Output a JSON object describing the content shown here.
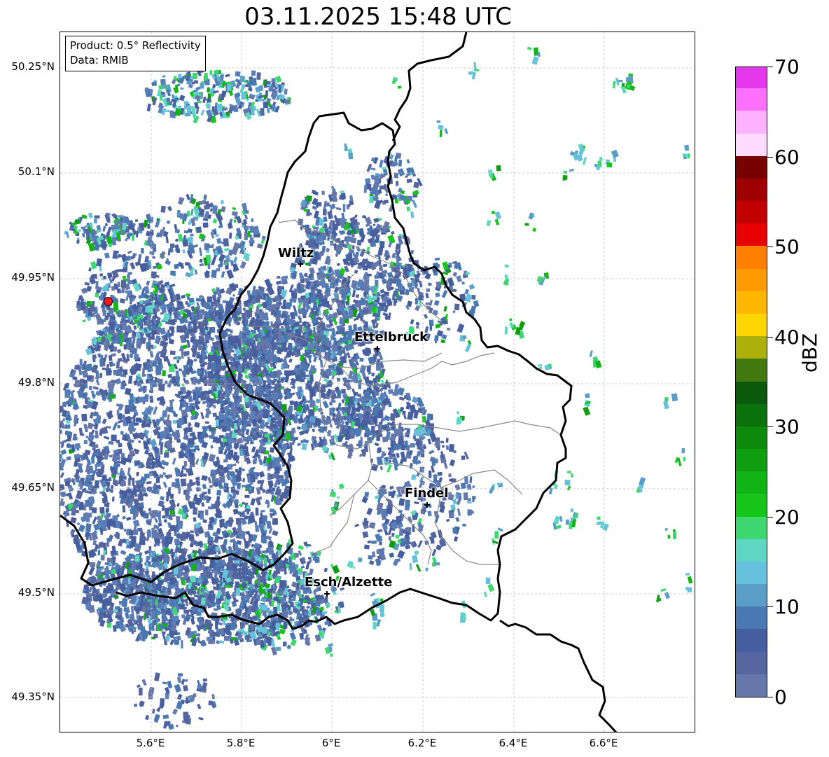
{
  "title": "03.11.2025 15:48 UTC",
  "info_box": {
    "product": "Product: 0.5° Reflectivity",
    "source": "Data: RMIB"
  },
  "axes": {
    "lat_labels": [
      "50.25°N",
      "50.1°N",
      "49.95°N",
      "49.8°N",
      "49.65°N",
      "49.5°N",
      "49.35°N"
    ],
    "lon_labels": [
      "5.6°E",
      "5.8°E",
      "6°E",
      "6.2°E",
      "6.4°E",
      "6.6°E"
    ]
  },
  "cities": [
    {
      "name": "Wiltz"
    },
    {
      "name": "Ettelbruck"
    },
    {
      "name": "Findel"
    },
    {
      "name": "Esch/Alzette"
    }
  ],
  "colorbar": {
    "label": "dBZ",
    "ticks": [
      "70",
      "60",
      "50",
      "40",
      "30",
      "20",
      "10",
      "0"
    ],
    "min": 0,
    "max": 70,
    "colors": [
      "#6677aa",
      "#55669e",
      "#445e9e",
      "#4a78b0",
      "#5a9ec8",
      "#66c2dc",
      "#5fd6c4",
      "#3ed66e",
      "#16c41a",
      "#10b414",
      "#0f9e10",
      "#0c8a0c",
      "#0a720a",
      "#0b5a0b",
      "#437a10",
      "#adb00a",
      "#ffd600",
      "#ffb600",
      "#ff9a00",
      "#ff7f00",
      "#e60000",
      "#c20000",
      "#9f0000",
      "#770000",
      "#ffdcff",
      "#ffb2ff",
      "#ff70ff",
      "#e437ee"
    ]
  },
  "colors": {
    "border_country": "#000000",
    "border_canton": "#888888",
    "grid": "#bbbbbb",
    "radar_site": "#ff1a1a"
  }
}
